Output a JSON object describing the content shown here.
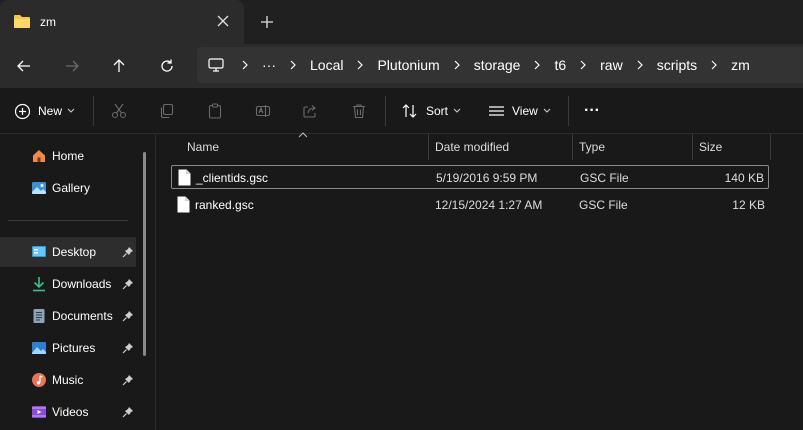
{
  "tab": {
    "title": "zm"
  },
  "breadcrumbs": [
    "Local",
    "Plutonium",
    "storage",
    "t6",
    "raw",
    "scripts",
    "zm"
  ],
  "breadcrumb_overflow": "···",
  "commands": {
    "new_label": "New",
    "sort_label": "Sort",
    "view_label": "View",
    "more_label": "···"
  },
  "columns": {
    "name": "Name",
    "date": "Date modified",
    "type": "Type",
    "size": "Size"
  },
  "sidebar": {
    "items": [
      {
        "label": "Home",
        "icon": "home-icon"
      },
      {
        "label": "Gallery",
        "icon": "gallery-icon"
      },
      {
        "label": "Desktop",
        "icon": "desktop-icon",
        "pinned": true,
        "selected": true
      },
      {
        "label": "Downloads",
        "icon": "downloads-icon",
        "pinned": true
      },
      {
        "label": "Documents",
        "icon": "documents-icon",
        "pinned": true
      },
      {
        "label": "Pictures",
        "icon": "pictures-icon",
        "pinned": true
      },
      {
        "label": "Music",
        "icon": "music-icon",
        "pinned": true
      },
      {
        "label": "Videos",
        "icon": "videos-icon",
        "pinned": true
      }
    ]
  },
  "files": [
    {
      "name": "_clientids.gsc",
      "date": "5/19/2016 9:59 PM",
      "type": "GSC File",
      "size": "140 KB"
    },
    {
      "name": "ranked.gsc",
      "date": "12/15/2024 1:27 AM",
      "type": "GSC File",
      "size": "12 KB"
    }
  ],
  "colors": {
    "accent": "#4cc2ff",
    "folder": "#f2c94c",
    "background": "#191919",
    "chrome": "#202020"
  }
}
